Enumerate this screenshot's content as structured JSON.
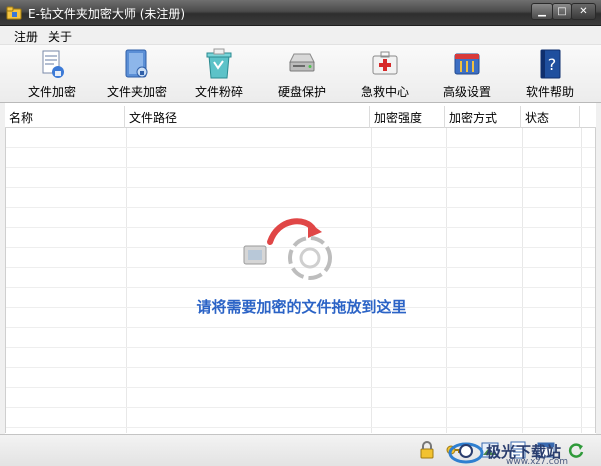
{
  "window": {
    "title": "E-钻文件夹加密大师 (未注册)",
    "controls": {
      "minimize": "▁",
      "maximize": "□",
      "close": "✕"
    }
  },
  "menu": {
    "items": [
      {
        "label": "注册"
      },
      {
        "label": "关于"
      }
    ]
  },
  "toolbar": {
    "items": [
      {
        "label": "文件加密",
        "icon": "file-lock-icon"
      },
      {
        "label": "文件夹加密",
        "icon": "folder-lock-icon"
      },
      {
        "label": "文件粉碎",
        "icon": "shredder-icon"
      },
      {
        "label": "硬盘保护",
        "icon": "hard-disk-icon"
      },
      {
        "label": "急救中心",
        "icon": "first-aid-icon"
      },
      {
        "label": "高级设置",
        "icon": "tools-icon"
      },
      {
        "label": "软件帮助",
        "icon": "help-book-icon"
      }
    ]
  },
  "list": {
    "columns": [
      "名称",
      "文件路径",
      "加密强度",
      "加密方式",
      "状态"
    ],
    "rows": []
  },
  "drop_area": {
    "hint": "请将需要加密的文件拖放到这里"
  },
  "statusbar": {
    "icons": [
      "lock-icon",
      "key-icon",
      "image-icon",
      "document-icon",
      "window-icon",
      "refresh-icon"
    ]
  },
  "watermark": {
    "text": "极光下载站",
    "url": "www.xz7.com"
  },
  "colors": {
    "accent": "#2b63c6",
    "titlebar": "#3c3c3c"
  }
}
